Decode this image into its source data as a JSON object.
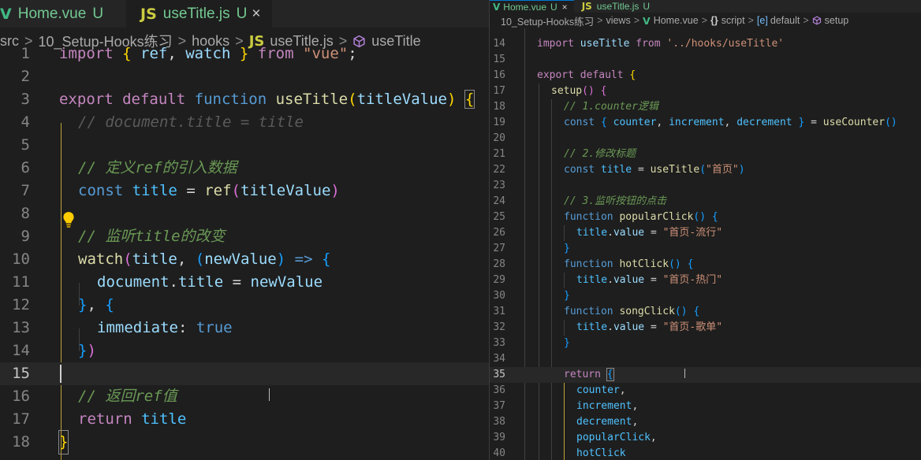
{
  "left_editor": {
    "tabs": [
      {
        "icon": "V",
        "name": "Home.vue",
        "status": "U"
      },
      {
        "icon": "JS",
        "name": "useTitle.js",
        "status": "U",
        "close": "×"
      }
    ],
    "breadcrumb": [
      {
        "label": "src"
      },
      {
        "label": "10_Setup-Hooks练习"
      },
      {
        "label": "hooks"
      },
      {
        "icon": "JS",
        "label": "useTitle.js"
      },
      {
        "icon": "cube",
        "label": "useTitle"
      }
    ],
    "line_numbers": [
      "1",
      "2",
      "3",
      "4",
      "5",
      "6",
      "7",
      "8",
      "9",
      "10",
      "11",
      "12",
      "13",
      "14",
      "15",
      "16",
      "17",
      "18"
    ],
    "code": {
      "l1": [
        "import",
        "{",
        "ref",
        ",",
        "watch",
        "}",
        "from",
        "\"vue\"",
        ";"
      ],
      "l3": [
        "export",
        "default",
        "function",
        "useTitle",
        "(",
        "titleValue",
        ")",
        "{"
      ],
      "l4": "// document.title = title",
      "l6": "// 定义ref的引入数据",
      "l7": [
        "const",
        "title",
        "=",
        "ref",
        "(",
        "titleValue",
        ")"
      ],
      "l9": "// 监听title的改变",
      "l10": [
        "watch",
        "(",
        "title",
        ", ",
        "(",
        "newValue",
        ")",
        "=>",
        "{"
      ],
      "l11": [
        "document",
        ".",
        "title",
        "=",
        "newValue"
      ],
      "l12": [
        "}",
        ", ",
        "{"
      ],
      "l13": [
        "immediate",
        ":",
        "true"
      ],
      "l14": [
        "}",
        ")"
      ],
      "l16": "// 返回ref值",
      "l17": [
        "return",
        "title"
      ],
      "l18": "}"
    }
  },
  "right_editor": {
    "tabs": [
      {
        "icon": "V",
        "name": "Home.vue",
        "status": "U",
        "close": "×"
      },
      {
        "icon": "JS",
        "name": "useTitle.js",
        "status": "U"
      }
    ],
    "breadcrumb": [
      {
        "label": "10_Setup-Hooks练习"
      },
      {
        "label": "views"
      },
      {
        "icon": "V",
        "label": "Home.vue"
      },
      {
        "icon": "{}",
        "label": "script"
      },
      {
        "icon": "[e]",
        "label": "default"
      },
      {
        "icon": "cube",
        "label": "setup"
      }
    ],
    "line_numbers": [
      "14",
      "15",
      "16",
      "17",
      "18",
      "19",
      "20",
      "21",
      "22",
      "23",
      "24",
      "25",
      "26",
      "27",
      "28",
      "29",
      "30",
      "31",
      "32",
      "33",
      "34",
      "35",
      "36",
      "37",
      "38",
      "39",
      "40"
    ],
    "code": {
      "l14": [
        "import",
        "useTitle",
        "from",
        "'../hooks/useTitle'"
      ],
      "l16": [
        "export",
        "default",
        "{"
      ],
      "l17": [
        "setup",
        "()",
        "{"
      ],
      "l18": "// 1.counter逻辑",
      "l19": [
        "const",
        "{",
        "counter",
        ", ",
        "increment",
        ", ",
        "decrement",
        "}",
        "=",
        "useCounter",
        "()"
      ],
      "l21": "// 2.修改标题",
      "l22": [
        "const",
        "title",
        "=",
        "useTitle",
        "(",
        "\"首页\"",
        ")"
      ],
      "l24": "// 3.监听按钮的点击",
      "l25": [
        "function",
        "popularClick",
        "()",
        "{"
      ],
      "l26": [
        "title",
        ".",
        "value",
        "=",
        "\"首页-流行\""
      ],
      "l27": "}",
      "l28": [
        "function",
        "hotClick",
        "()",
        "{"
      ],
      "l29": [
        "title",
        ".",
        "value",
        "=",
        "\"首页-热门\""
      ],
      "l30": "}",
      "l31": [
        "function",
        "songClick",
        "()",
        "{"
      ],
      "l32": [
        "title",
        ".",
        "value",
        "=",
        "\"首页-歌单\""
      ],
      "l33": "}",
      "l35": [
        "return",
        "{"
      ],
      "l36": [
        "counter",
        ","
      ],
      "l37": [
        "increment",
        ","
      ],
      "l38": [
        "decrement",
        ","
      ],
      "l39": [
        "popularClick",
        ","
      ],
      "l40": "hotClick"
    }
  },
  "colors": {
    "keyword": "#569cd6",
    "control": "#c586c0",
    "function": "#dcdcaa",
    "variable": "#9cdcfe",
    "constant": "#4fc1ff",
    "string": "#ce9178",
    "comment": "#6a9955",
    "git_untracked": "#73c991"
  },
  "icons": [
    "vue-icon",
    "js-icon",
    "close-icon",
    "chevron-right-icon",
    "symbol-method-icon",
    "braces-icon",
    "symbol-variable-icon",
    "lightbulb-icon"
  ]
}
